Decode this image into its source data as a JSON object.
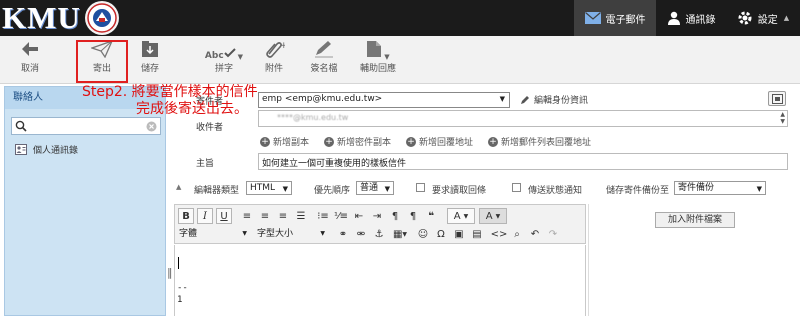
{
  "brand": {
    "logo_text": "KMU"
  },
  "nav": {
    "mail_label": "電子郵件",
    "contacts_label": "通訊錄",
    "settings_label": "設定",
    "settings_arrow": "▲"
  },
  "toolbar": {
    "cancel": "取消",
    "send": "寄出",
    "save": "儲存",
    "spell": "拼字",
    "attach": "附件",
    "signature": "簽名檔",
    "reply_assist": "輔助回應",
    "spell_abc": "Abc"
  },
  "annotation": {
    "line1": "Step2. 將要當作樣本的信件",
    "line2": "完成後寄送出去。"
  },
  "sidebar": {
    "title": "聯絡人",
    "search_placeholder": "",
    "items": [
      {
        "label": "個人通訊錄"
      }
    ]
  },
  "compose": {
    "from_label": "寄件者",
    "from_value": "emp <emp@kmu.edu.tw>",
    "edit_identity": "編輯身份資訊",
    "to_label": "收件者",
    "to_value": "****@kmu.edu.tw",
    "add_cc": "新增副本",
    "add_bcc": "新增密件副本",
    "add_reply_to": "新增回覆地址",
    "add_followup": "新增郵件列表回覆地址",
    "subject_label": "主旨",
    "subject_value": "如何建立一個可重複使用的樣板信件",
    "editor_type_label": "編輯器類型",
    "editor_type_value": "HTML",
    "priority_label": "優先順序",
    "priority_value": "普通",
    "receipt_label": "要求讀取回條",
    "dsn_label": "傳送狀態通知",
    "save_sent_label": "儲存寄件備份至",
    "save_sent_value": "寄件備份",
    "attach_button": "加入附件檔案"
  },
  "editor": {
    "font_family": "字體",
    "font_size": "字型大小",
    "sig_dash": "--",
    "sig_line": "1"
  }
}
